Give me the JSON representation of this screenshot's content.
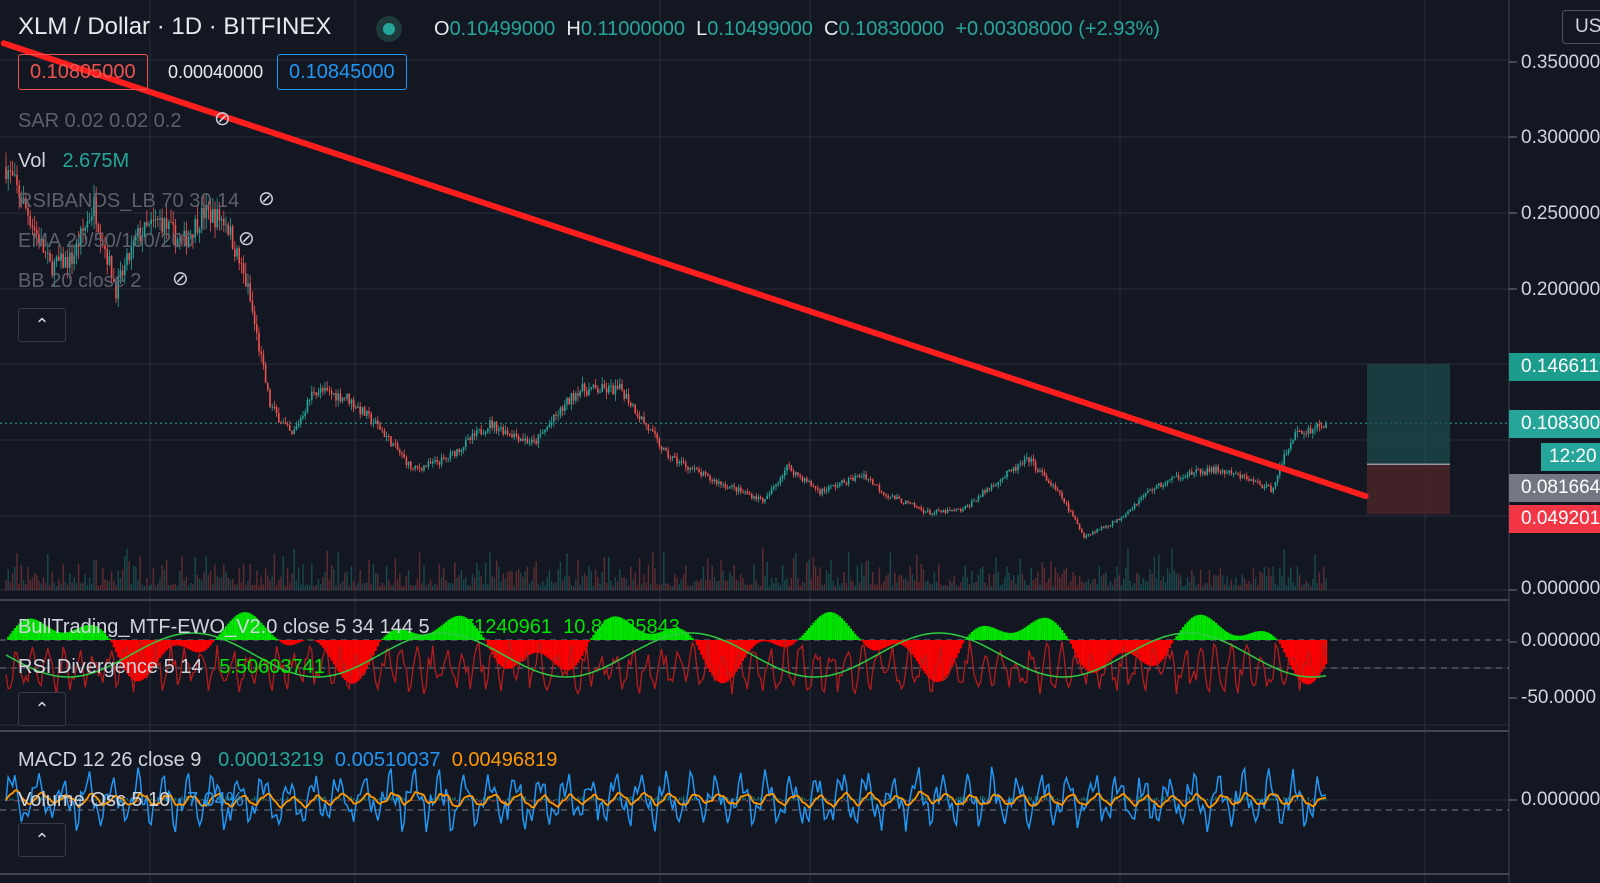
{
  "header": {
    "title": "XLM / Dollar · 1D · BITFINEX",
    "ohlc": [
      {
        "k": "O",
        "v": "0.10499000"
      },
      {
        "k": "H",
        "v": "0.11000000"
      },
      {
        "k": "L",
        "v": "0.10499000"
      },
      {
        "k": "C",
        "v": "0.10830000"
      }
    ],
    "change": "+0.00308000 (+2.93%)",
    "sell_price": "0.10805000",
    "spread": "0.00040000",
    "buy_price": "0.10845000",
    "currency_button": "USD"
  },
  "indicators": {
    "sar": "SAR 0.02 0.02 0.2",
    "vol_label": "Vol",
    "vol_value": "2.675M",
    "rsibands": "RSIBANDS_LB 70 30 14",
    "ema": "EMA 20/50/100/200",
    "bb": "BB 20 close 2",
    "ewo_label": "BullTrading_MTF-EWO_V2.0 close 5 34 144 5",
    "ewo_v1": "8.71240961",
    "ewo_v2": "10.82225843",
    "rsidiv_label": "RSI Divergence 5 14",
    "rsidiv_v": "5.50603741",
    "macd_label": "MACD 12 26 close 9",
    "macd_v1": "0.00013219",
    "macd_v2": "0.00510037",
    "macd_v3": "0.00496819",
    "volosc_label": "Volume Osc 5 10",
    "volosc_v": "7.04%"
  },
  "price_axis": {
    "labels": [
      "0.3500000",
      "0.3000000",
      "0.2500000",
      "0.2000000",
      "0.0000000"
    ],
    "tags": {
      "target": "0.1466119",
      "last": "0.1083000",
      "countdown": "12:20",
      "entry": "0.0816641",
      "stop": "0.0492016"
    }
  },
  "pane2_axis": [
    "0.0000000",
    "-50.0000"
  ],
  "pane3_axis": [
    "0.0000000"
  ],
  "colors": {
    "background": "#131722",
    "up": "#26a69a",
    "down": "#ef5350",
    "trendline": "#ff1e1e",
    "ewo_pos": "#00e600",
    "ewo_neg": "#ff0000",
    "macd": "#2196f3",
    "signal": "#ff9800"
  },
  "chart_data": {
    "type": "candlestick",
    "symbol": "XLM / Dollar",
    "interval": "1D",
    "exchange": "BITFINEX",
    "last_close": 0.1083,
    "price_axis_ticks": [
      0.35,
      0.3,
      0.25,
      0.2,
      0.0
    ],
    "waypoints_close": [
      {
        "bar": 0,
        "price": 0.275
      },
      {
        "bar": 10,
        "price": 0.245
      },
      {
        "bar": 20,
        "price": 0.21
      },
      {
        "bar": 30,
        "price": 0.215
      },
      {
        "bar": 40,
        "price": 0.25
      },
      {
        "bar": 50,
        "price": 0.195
      },
      {
        "bar": 60,
        "price": 0.23
      },
      {
        "bar": 70,
        "price": 0.24
      },
      {
        "bar": 80,
        "price": 0.225
      },
      {
        "bar": 90,
        "price": 0.245
      },
      {
        "bar": 100,
        "price": 0.24
      },
      {
        "bar": 110,
        "price": 0.195
      },
      {
        "bar": 120,
        "price": 0.12
      },
      {
        "bar": 130,
        "price": 0.1
      },
      {
        "bar": 140,
        "price": 0.13
      },
      {
        "bar": 155,
        "price": 0.125
      },
      {
        "bar": 170,
        "price": 0.105
      },
      {
        "bar": 185,
        "price": 0.078
      },
      {
        "bar": 200,
        "price": 0.085
      },
      {
        "bar": 220,
        "price": 0.108
      },
      {
        "bar": 240,
        "price": 0.095
      },
      {
        "bar": 260,
        "price": 0.13
      },
      {
        "bar": 280,
        "price": 0.13
      },
      {
        "bar": 300,
        "price": 0.088
      },
      {
        "bar": 320,
        "price": 0.072
      },
      {
        "bar": 345,
        "price": 0.058
      },
      {
        "bar": 355,
        "price": 0.08
      },
      {
        "bar": 370,
        "price": 0.064
      },
      {
        "bar": 390,
        "price": 0.075
      },
      {
        "bar": 400,
        "price": 0.062
      },
      {
        "bar": 420,
        "price": 0.05
      },
      {
        "bar": 435,
        "price": 0.052
      },
      {
        "bar": 450,
        "price": 0.07
      },
      {
        "bar": 465,
        "price": 0.085
      },
      {
        "bar": 480,
        "price": 0.06
      },
      {
        "bar": 490,
        "price": 0.035
      },
      {
        "bar": 505,
        "price": 0.045
      },
      {
        "bar": 520,
        "price": 0.065
      },
      {
        "bar": 535,
        "price": 0.075
      },
      {
        "bar": 550,
        "price": 0.078
      },
      {
        "bar": 565,
        "price": 0.072
      },
      {
        "bar": 575,
        "price": 0.065
      },
      {
        "bar": 585,
        "price": 0.1
      },
      {
        "bar": 600,
        "price": 0.1083
      }
    ],
    "trendline": {
      "from": {
        "bar": -1,
        "price": 0.355
      },
      "to": {
        "bar": 618,
        "price": 0.061
      }
    },
    "position": {
      "target": 0.1466119,
      "entry": 0.0816641,
      "stop": 0.0492016
    }
  }
}
